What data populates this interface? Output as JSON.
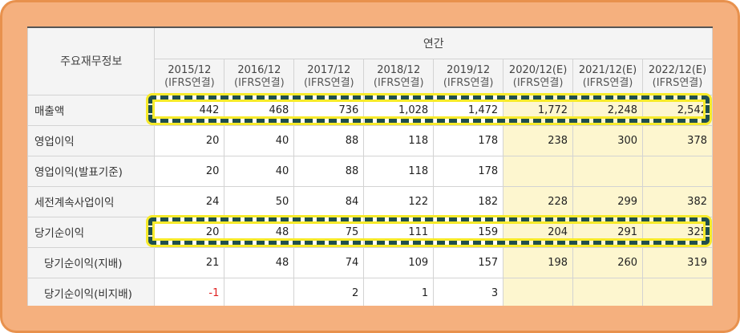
{
  "table": {
    "corner_label": "주요재무정보",
    "period_label": "연간",
    "years": [
      {
        "year": "2015/12",
        "basis": "(IFRS연결)",
        "estimate": false
      },
      {
        "year": "2016/12",
        "basis": "(IFRS연결)",
        "estimate": false
      },
      {
        "year": "2017/12",
        "basis": "(IFRS연결)",
        "estimate": false
      },
      {
        "year": "2018/12",
        "basis": "(IFRS연결)",
        "estimate": false
      },
      {
        "year": "2019/12",
        "basis": "(IFRS연결)",
        "estimate": false
      },
      {
        "year": "2020/12(E)",
        "basis": "(IFRS연결)",
        "estimate": true
      },
      {
        "year": "2021/12(E)",
        "basis": "(IFRS연결)",
        "estimate": true
      },
      {
        "year": "2022/12(E)",
        "basis": "(IFRS연결)",
        "estimate": true
      }
    ],
    "rows": [
      {
        "label": "매출액",
        "indent": false,
        "values": [
          "442",
          "468",
          "736",
          "1,028",
          "1,472",
          "1,772",
          "2,248",
          "2,542"
        ]
      },
      {
        "label": "영업이익",
        "indent": false,
        "values": [
          "20",
          "40",
          "88",
          "118",
          "178",
          "238",
          "300",
          "378"
        ]
      },
      {
        "label": "영업이익(발표기준)",
        "indent": false,
        "values": [
          "20",
          "40",
          "88",
          "118",
          "178",
          "",
          "",
          ""
        ]
      },
      {
        "label": "세전계속사업이익",
        "indent": false,
        "values": [
          "24",
          "50",
          "84",
          "122",
          "182",
          "228",
          "299",
          "382"
        ]
      },
      {
        "label": "당기순이익",
        "indent": false,
        "values": [
          "20",
          "48",
          "75",
          "111",
          "159",
          "204",
          "291",
          "325"
        ]
      },
      {
        "label": "당기순이익(지배)",
        "indent": true,
        "values": [
          "21",
          "48",
          "74",
          "109",
          "157",
          "198",
          "260",
          "319"
        ]
      },
      {
        "label": "당기순이익(비지배)",
        "indent": true,
        "values": [
          "-1",
          "",
          "2",
          "1",
          "3",
          "",
          "",
          ""
        ]
      }
    ]
  },
  "colors": {
    "frame": "#f5b07e",
    "estimate_bg": "#fdf6cf",
    "highlight_dash": "#1f4e4e",
    "highlight_glow": "#f7ea2a",
    "negative": "#e02020"
  }
}
